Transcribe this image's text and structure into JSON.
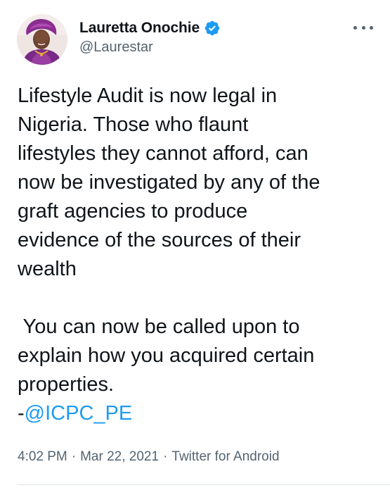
{
  "author": {
    "display_name": "Lauretta Onochie",
    "handle": "@Laurestar",
    "verified": true,
    "avatar_icon": "profile-photo"
  },
  "tweet": {
    "lines": [
      "Lifestyle Audit is now legal in",
      "Nigeria. Those who flaunt",
      "lifestyles they cannot afford, can",
      "now be investigated by any of the",
      "graft agencies to produce",
      "evidence of the sources of their",
      "wealth",
      "",
      " You can now be called upon to",
      "explain how you acquired certain",
      "properties."
    ],
    "mention_prefix": "-",
    "mention": "@ICPC_PE"
  },
  "meta": {
    "time": "4:02 PM",
    "separator": "·",
    "date": "Mar 22, 2021",
    "source": "Twitter for Android"
  },
  "colors": {
    "text": "#0f1419",
    "secondary": "#536471",
    "link": "#1d9bf0",
    "verified_badge": "#1d9bf0"
  },
  "icons": {
    "verified": "verified-badge-icon",
    "more": "more-horizontal-icon"
  }
}
